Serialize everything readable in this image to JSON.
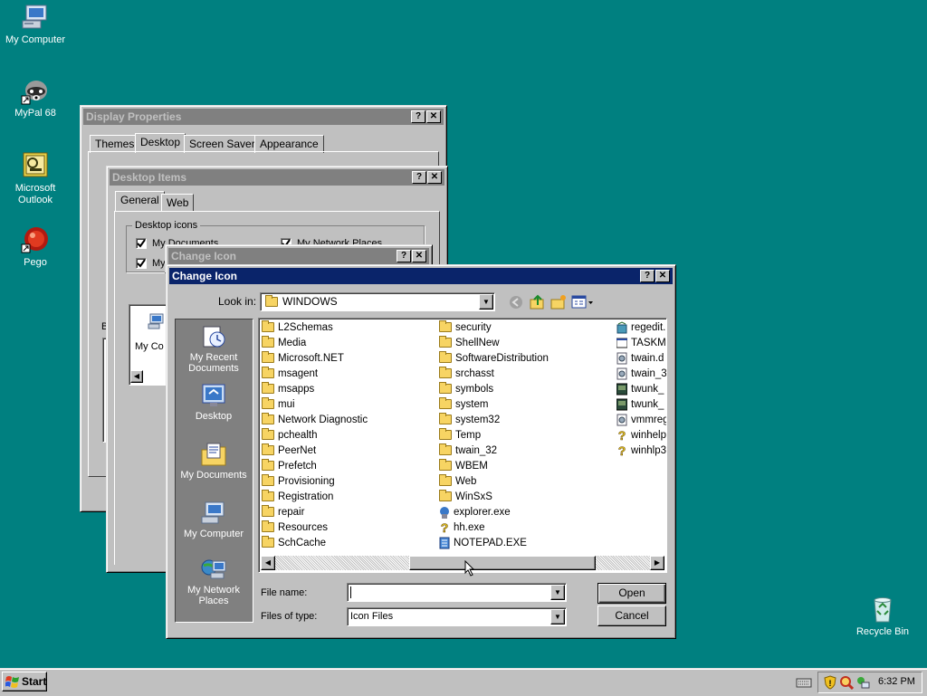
{
  "desktop_icons": [
    {
      "label": "My Computer",
      "icon": "computer-icon"
    },
    {
      "label": "MyPal 68",
      "icon": "raccoon-icon"
    },
    {
      "label": "Microsoft Outlook",
      "icon": "outlook-icon"
    },
    {
      "label": "Pego",
      "icon": "red-ball-icon"
    },
    {
      "label": "Recycle Bin",
      "icon": "recycle-bin-icon"
    }
  ],
  "display_properties": {
    "title": "Display Properties",
    "tabs": [
      "Themes",
      "Desktop",
      "Screen Saver",
      "Appearance"
    ],
    "partial_label": "B"
  },
  "desktop_items": {
    "title": "Desktop Items",
    "tabs": [
      "General",
      "Web"
    ],
    "group_label": "Desktop icons",
    "checkboxes": [
      "My Documents",
      "My Network Places",
      "My"
    ],
    "list_partial": "My Co"
  },
  "change_icon_inactive": {
    "title": "Change Icon"
  },
  "change_icon": {
    "title": "Change Icon",
    "look_in_label": "Look in:",
    "look_in_value": "WINDOWS",
    "places": [
      "My Recent Documents",
      "Desktop",
      "My Documents",
      "My Computer",
      "My Network Places"
    ],
    "col1": [
      "L2Schemas",
      "Media",
      "Microsoft.NET",
      "msagent",
      "msapps",
      "mui",
      "Network Diagnostic",
      "pchealth",
      "PeerNet",
      "Prefetch",
      "Provisioning",
      "Registration",
      "repair",
      "Resources",
      "SchCache"
    ],
    "col2": [
      {
        "name": "security",
        "type": "folder"
      },
      {
        "name": "ShellNew",
        "type": "folder"
      },
      {
        "name": "SoftwareDistribution",
        "type": "folder"
      },
      {
        "name": "srchasst",
        "type": "folder"
      },
      {
        "name": "symbols",
        "type": "folder"
      },
      {
        "name": "system",
        "type": "folder"
      },
      {
        "name": "system32",
        "type": "folder"
      },
      {
        "name": "Temp",
        "type": "folder"
      },
      {
        "name": "twain_32",
        "type": "folder"
      },
      {
        "name": "WBEM",
        "type": "folder"
      },
      {
        "name": "Web",
        "type": "folder"
      },
      {
        "name": "WinSxS",
        "type": "folder"
      },
      {
        "name": "explorer.exe",
        "type": "exe"
      },
      {
        "name": "hh.exe",
        "type": "help"
      },
      {
        "name": "NOTEPAD.EXE",
        "type": "notepad"
      }
    ],
    "col3": [
      {
        "name": "regedit.",
        "type": "regedit"
      },
      {
        "name": "TASKM",
        "type": "window"
      },
      {
        "name": "twain.d",
        "type": "dll"
      },
      {
        "name": "twain_3",
        "type": "dll"
      },
      {
        "name": "twunk_",
        "type": "scanner"
      },
      {
        "name": "twunk_",
        "type": "scanner"
      },
      {
        "name": "vmmreg",
        "type": "dll"
      },
      {
        "name": "winhelp",
        "type": "help"
      },
      {
        "name": "winhlp3",
        "type": "help"
      }
    ],
    "file_name_label": "File name:",
    "file_name_value": "",
    "files_of_type_label": "Files of type:",
    "files_of_type_value": "Icon Files",
    "open_button": "Open",
    "cancel_button": "Cancel"
  },
  "taskbar": {
    "start_label": "Start",
    "clock": "6:32 PM"
  }
}
